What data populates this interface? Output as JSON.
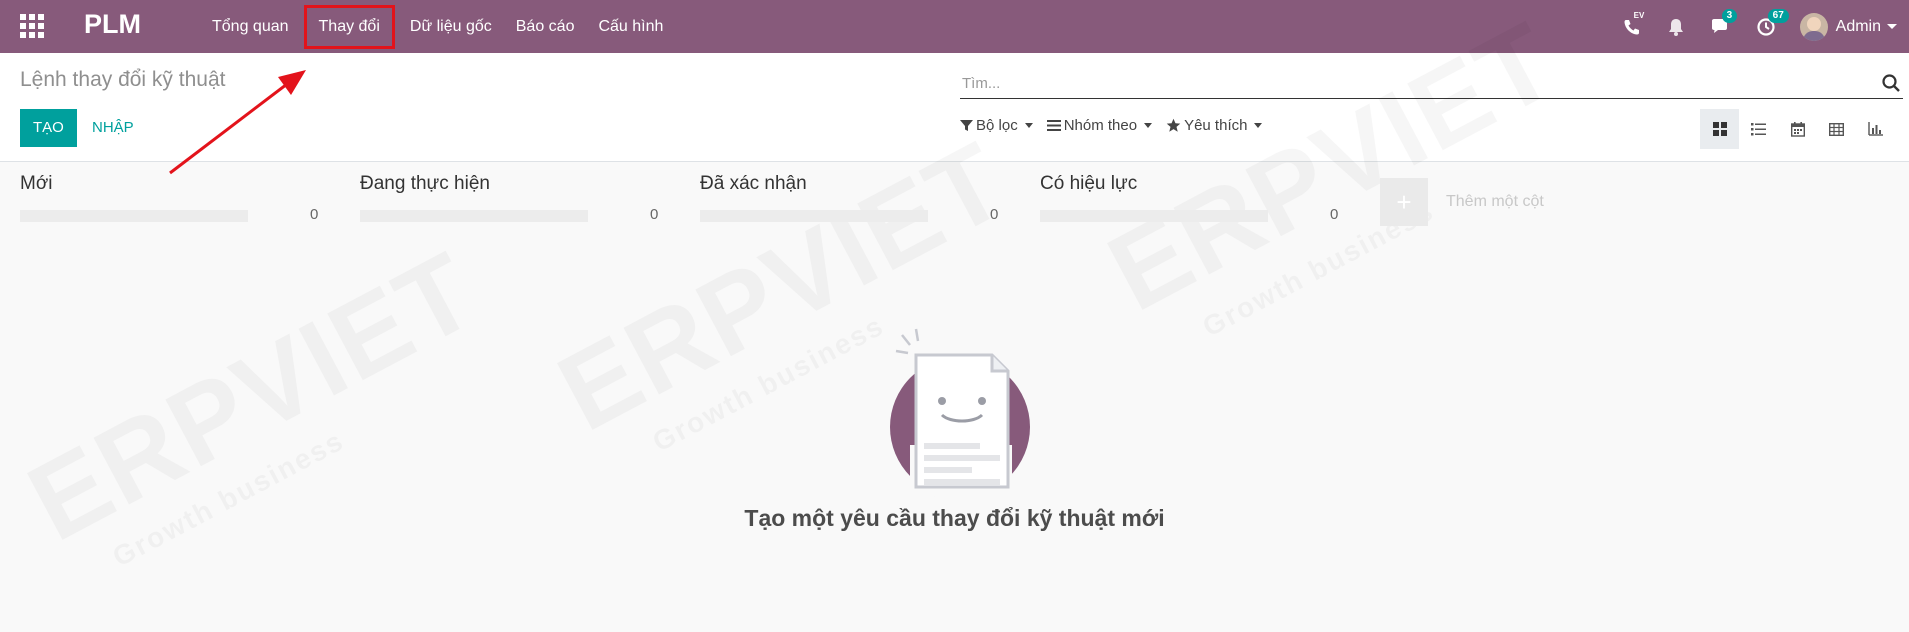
{
  "navbar": {
    "brand": "PLM",
    "menu": [
      "Tổng quan",
      "Thay đổi",
      "Dữ liệu gốc",
      "Báo cáo",
      "Cấu hình"
    ],
    "active_menu": "Thay đổi",
    "tray": {
      "voip_label": "EV",
      "messages_count": "3",
      "activities_count": "67",
      "user_name": "Admin"
    }
  },
  "control_panel": {
    "breadcrumb": "Lệnh thay đổi kỹ thuật",
    "create_label": "TẠO",
    "import_label": "NHẬP",
    "search_placeholder": "Tìm...",
    "filters_label": "Bộ lọc",
    "group_by_label": "Nhóm theo",
    "favorites_label": "Yêu thích"
  },
  "kanban": {
    "columns": [
      {
        "title": "Mới",
        "count": "0"
      },
      {
        "title": "Đang thực hiện",
        "count": "0"
      },
      {
        "title": "Đã xác nhận",
        "count": "0"
      },
      {
        "title": "Có hiệu lực",
        "count": "0"
      }
    ],
    "add_column_label": "Thêm một cột"
  },
  "empty_state": {
    "title": "Tạo một yêu cầu thay đổi kỹ thuật mới"
  },
  "watermark": {
    "text": "ERPVIET",
    "tagline": "Growth business"
  },
  "colors": {
    "navbar": "#875a7b",
    "primary": "#00a09d",
    "highlight": "#e3131b"
  }
}
